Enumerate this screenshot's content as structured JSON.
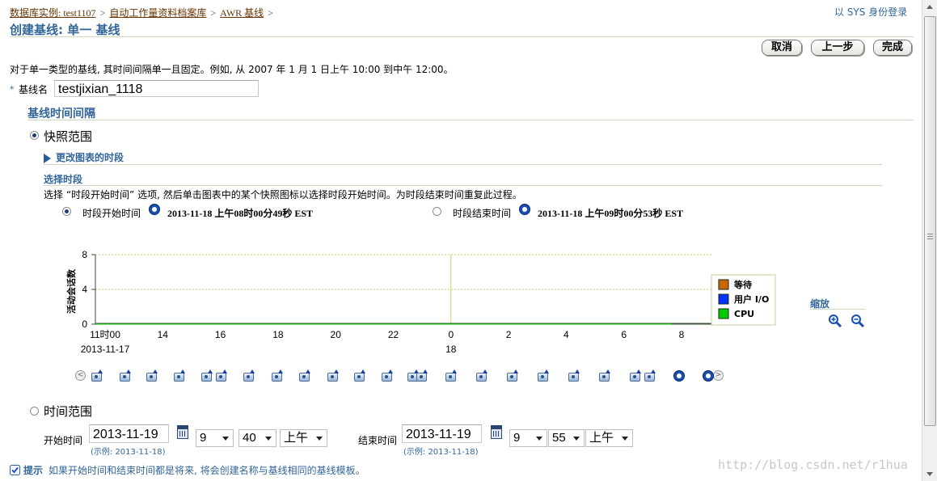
{
  "breadcrumb": {
    "items": [
      "数据库实例: test1107",
      "自动工作量资料档案库",
      "AWR 基线"
    ],
    "separator": ">"
  },
  "login_info": "以 SYS 身份登录",
  "page_title": "创建基线: 单一  基线",
  "buttons": {
    "cancel": "取消",
    "back": "上一步",
    "finish": "完成"
  },
  "description": "对于单一类型的基线, 其时间间隔单一且固定。例如, 从  2007 年  1 月  1 日上午  10:00 到中午  12:00。",
  "baseline_name": {
    "required_marker": "*",
    "label": "基线名",
    "value": "testjixian_1118"
  },
  "interval_section_title": "基线时间间隔",
  "snapshot_range": {
    "label": "快照范围",
    "selected": true,
    "change_chart_period_link": "更改图表的时段",
    "select_period_title": "选择时段",
    "instruction": "选择 “时段开始时间” 选项, 然后单击图表中的某个快照图标以选择时段开始时间。为时段结束时间重复此过程。",
    "start": {
      "label": "时段开始时间",
      "value": "2013-11-18 上午08时00分49秒  EST",
      "selected": true
    },
    "end": {
      "label": "时段结束时间",
      "value": "2013-11-18 上午09时00分53秒  EST",
      "selected": false
    }
  },
  "chart_data": {
    "type": "area",
    "title": "",
    "ylabel": "活动会话数",
    "xlabel": "",
    "ylim": [
      0,
      8
    ],
    "y_ticks": [
      "0",
      "4",
      "8"
    ],
    "x_tick_labels": [
      "11时00",
      "14",
      "16",
      "18",
      "20",
      "22",
      "0",
      "2",
      "4",
      "6",
      "8"
    ],
    "x_sub_labels": [
      {
        "under": "11时00",
        "text": "2013-11-17"
      },
      {
        "under": "0",
        "text": "18"
      }
    ],
    "series": [
      {
        "name": "等待",
        "color": "#cc6600",
        "values": [
          0,
          0,
          0,
          0,
          0,
          0,
          0,
          0,
          0,
          0,
          0
        ]
      },
      {
        "name": "用户 I/O",
        "color": "#0033ff",
        "values": [
          0,
          0,
          0,
          0,
          0,
          0,
          0,
          0,
          0,
          0,
          0
        ]
      },
      {
        "name": "CPU",
        "color": "#00cc00",
        "values": [
          0,
          0,
          0,
          0,
          0,
          0,
          0,
          0,
          0,
          0,
          0
        ]
      }
    ],
    "legend_position": "right",
    "grid": true
  },
  "zoom": {
    "label": "缩放"
  },
  "time_range": {
    "label": "时间范围",
    "selected": false,
    "start_label": "开始时间",
    "start_date": "2013-11-19",
    "start_example": "(示例: 2013-11-18)",
    "start_hour": "9",
    "start_minute": "40",
    "start_ampm": "上午",
    "end_label": "结束时间",
    "end_date": "2013-11-19",
    "end_example": "(示例: 2013-11-18)",
    "end_hour": "9",
    "end_minute": "55",
    "end_ampm": "上午"
  },
  "tip": {
    "label": "提示",
    "text": "如果开始时间和结束时间都是将来, 将会创建名称与基线相同的基线模板。"
  },
  "watermark": "http://blog.csdn.net/r1hua",
  "colors": {
    "title_blue": "#336699",
    "link_brown": "#663300",
    "grid_olive": "#cccc99"
  }
}
